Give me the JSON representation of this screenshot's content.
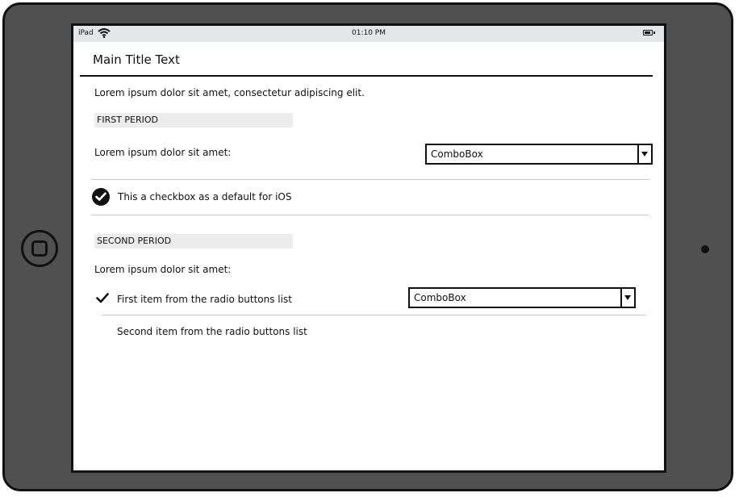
{
  "status_bar": {
    "carrier": "iPad",
    "time": "01:10 PM"
  },
  "header": {
    "title": "Main Title Text"
  },
  "intro_text": "Lorem ipsum dolor sit amet, consectetur adipiscing elit.",
  "first_period": {
    "header": "FIRST PERIOD",
    "field_label": "Lorem ipsum dolor sit amet:",
    "combobox_value": "ComboBox",
    "checkbox_label": "This a checkbox as a default for iOS",
    "checkbox_checked": true
  },
  "second_period": {
    "header": "SECOND PERIOD",
    "field_label": "Lorem ipsum dolor sit amet:",
    "radio_items": [
      {
        "label": "First item from the radio buttons list",
        "selected": true
      },
      {
        "label": "Second item from the radio buttons list",
        "selected": false
      }
    ],
    "combobox_value": "ComboBox"
  },
  "icons": {
    "wifi": "wifi-icon",
    "battery": "battery-icon",
    "checkbox": "checkbox-checked-icon",
    "radio_check": "checkmark-icon",
    "dropdown": "chevron-down-icon",
    "home": "home-button-icon"
  }
}
